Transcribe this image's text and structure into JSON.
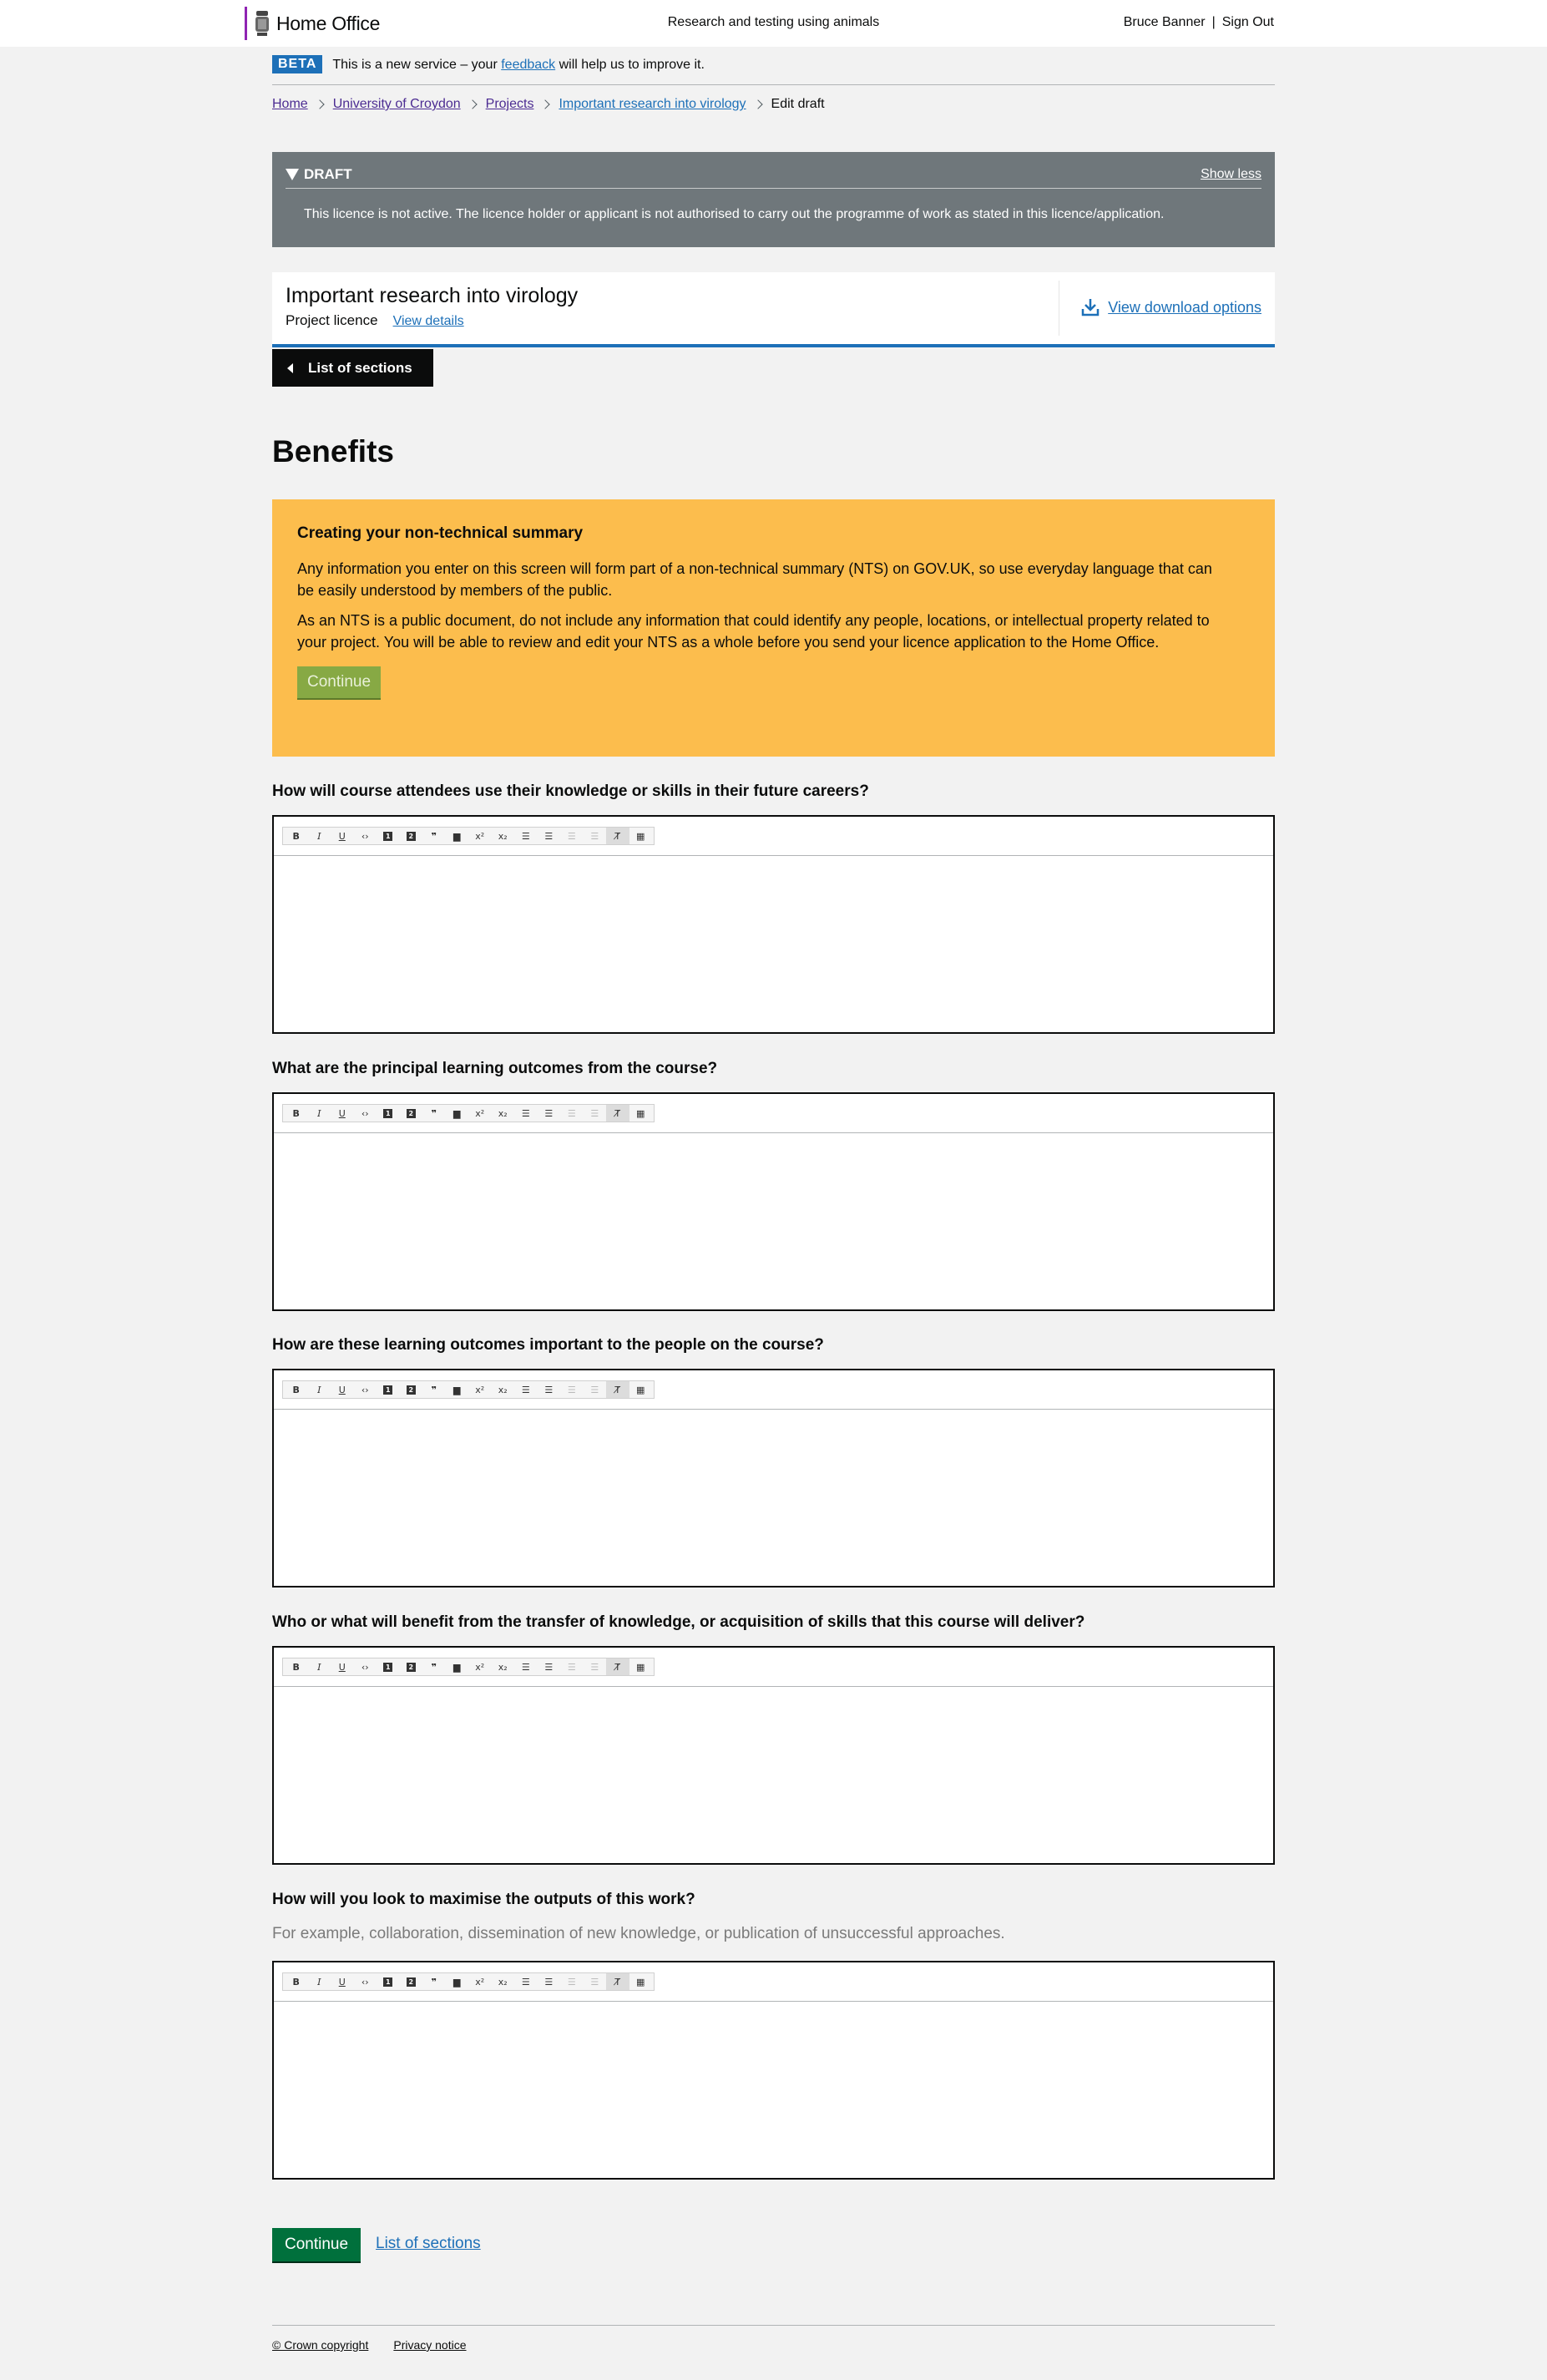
{
  "header": {
    "logo_text": "Home Office",
    "service_name": "Research and testing using animals",
    "user_name": "Bruce Banner",
    "separator": "|",
    "sign_out": "Sign Out"
  },
  "phase_banner": {
    "tag": "BETA",
    "text_before": "This is a new service – your ",
    "link": "feedback",
    "text_after": " will help us to improve it."
  },
  "breadcrumbs": [
    "Home",
    "University of Croydon",
    "Projects",
    "Important research into virology",
    "Edit draft"
  ],
  "draft_panel": {
    "title": "DRAFT",
    "toggle": "Show less",
    "message": "This licence is not active. The licence holder or applicant is not authorised to carry out the programme of work as stated in this licence/application."
  },
  "project": {
    "title": "Important research into virology",
    "type": "Project licence",
    "details_link": "View details",
    "download_link": "View download options"
  },
  "list_button": "List of sections",
  "page_title": "Benefits",
  "nts": {
    "heading": "Creating your non-technical summary",
    "para1": "Any information you enter on this screen will form part of a non-technical summary (NTS) on GOV.UK, so use everyday language that can be easily understood by members of the public.",
    "para2": "As an NTS is a public document, do not include any information that could identify any people, locations, or intellectual property related to your project. You will be able to review and edit your NTS as a whole before you send your licence application to the Home Office.",
    "button": "Continue"
  },
  "questions": [
    {
      "label": "How will course attendees use their knowledge or skills in their future careers?",
      "hint": "",
      "value": ""
    },
    {
      "label": "What are the principal learning outcomes from the course?",
      "hint": "",
      "value": ""
    },
    {
      "label": "How are these learning outcomes important to the people on the course?",
      "hint": "",
      "value": ""
    },
    {
      "label": "Who or what will benefit from the transfer of knowledge, or acquisition of skills that this course will deliver?",
      "hint": "",
      "value": ""
    },
    {
      "label": "How will you look to maximise the outputs of this work?",
      "hint": "For example, collaboration, dissemination of new knowledge, or publication of unsuccessful approaches.",
      "value": ""
    }
  ],
  "toolbar": {
    "bold": "B",
    "italic": "I",
    "underline": "U",
    "code": "‹›",
    "h1": "1",
    "h2": "2",
    "quote": "❞",
    "image": "▆",
    "superscript": "x²",
    "subscript": "x₂",
    "numbered_list": "☰",
    "bulleted_list": "☰",
    "indent": "☰",
    "outdent": "☰",
    "clear_format": "T̸",
    "table": "▦"
  },
  "actions": {
    "continue": "Continue",
    "list_link": "List of sections"
  },
  "footer": {
    "copyright": "© Crown copyright",
    "privacy": "Privacy notice"
  }
}
